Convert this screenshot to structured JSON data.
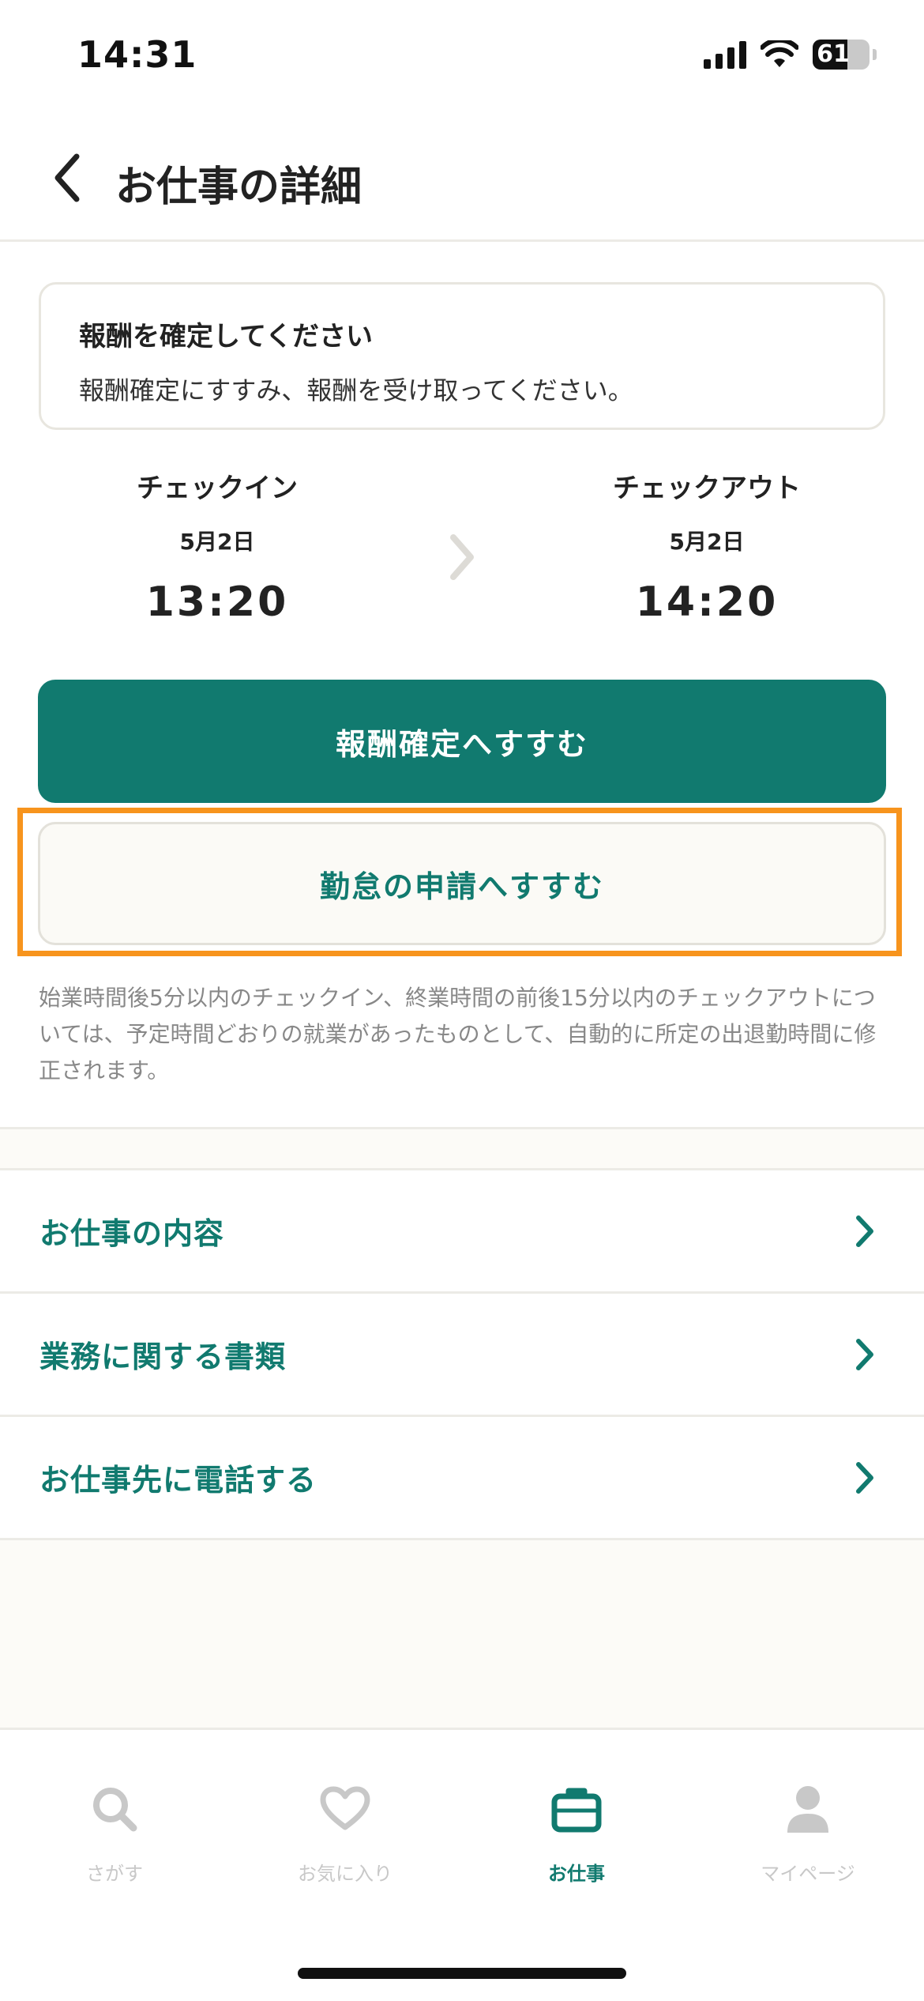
{
  "status_bar": {
    "time": "14:31",
    "battery_level": "61"
  },
  "header": {
    "title": "お仕事の詳細",
    "back_icon": "chevron-left-icon"
  },
  "notice": {
    "title": "報酬を確定してください",
    "body": "報酬確定にすすみ、報酬を受け取ってください。"
  },
  "check_in": {
    "label": "チェックイン",
    "date": "5月2日",
    "time": "13:20"
  },
  "check_out": {
    "label": "チェックアウト",
    "date": "5月2日",
    "time": "14:20"
  },
  "buttons": {
    "confirm_reward": "報酬確定へすすむ",
    "attendance_request": "勤怠の申請へすすむ"
  },
  "note": "始業時間後5分以内のチェックイン、終業時間の前後15分以内のチェックアウトについては、予定時間どおりの就業があったものとして、自動的に所定の出退勤時間に修正されます。",
  "menu": [
    {
      "label": "お仕事の内容"
    },
    {
      "label": "業務に関する書類"
    },
    {
      "label": "お仕事先に電話する"
    }
  ],
  "tabs": [
    {
      "label": "さがす",
      "icon": "search-icon"
    },
    {
      "label": "お気に入り",
      "icon": "heart-icon"
    },
    {
      "label": "お仕事",
      "icon": "briefcase-icon",
      "active": true
    },
    {
      "label": "マイページ",
      "icon": "person-icon"
    }
  ],
  "colors": {
    "accent": "#117a6f",
    "highlight": "#f7941d",
    "muted": "#c8c8c8"
  }
}
